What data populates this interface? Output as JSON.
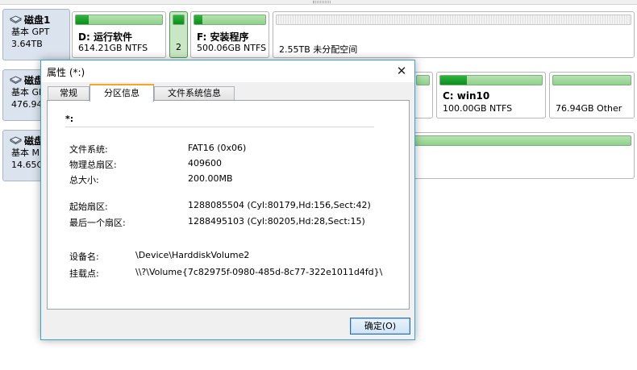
{
  "disks": [
    {
      "name": "磁盘1",
      "type": "基本 GPT",
      "size": "3.64TB",
      "partitions": [
        {
          "title": "D: 运行软件",
          "size": "614.21GB NTFS",
          "fill": 0.15
        },
        {
          "number": "2",
          "fill": 1.0
        },
        {
          "title": "F: 安装程序",
          "size": "500.06GB NTFS",
          "fill": 0.11
        },
        {
          "title": "",
          "size": "2.55TB 未分配空间",
          "unallocated": true
        }
      ]
    },
    {
      "name": "磁盘",
      "type": "基本 GI",
      "size": "476.94",
      "partitions": [
        {
          "title": "C: win10",
          "size": "100.00GB NTFS",
          "fill": 0.26
        },
        {
          "title": "",
          "size": "76.94GB Other",
          "fill": 0.0
        }
      ]
    },
    {
      "name": "磁盘",
      "type": "基本 M",
      "size": "14.65G",
      "partitions": [
        {
          "title": "",
          "size": "",
          "fill": 0.0
        }
      ]
    }
  ],
  "dialog": {
    "title": "属性 (*:)",
    "close_glyph": "✕",
    "tabs": [
      "常规",
      "分区信息",
      "文件系统信息"
    ],
    "active_tab": "分区信息",
    "drive_label": "*:",
    "fields": [
      {
        "label": "文件系统:",
        "value": "FAT16 (0x06)"
      },
      {
        "label": "物理总扇区:",
        "value": "409600"
      },
      {
        "label": "总大小:",
        "value": "200.00MB"
      },
      {
        "label": "起始扇区:",
        "value": "1288085504  (Cyl:80179,Hd:156,Sect:42)"
      },
      {
        "label": "最后一个扇区:",
        "value": "1288495103  (Cyl:80205,Hd:28,Sect:15)"
      },
      {
        "label": "设备名:",
        "value": "\\Device\\HarddiskVolume2"
      },
      {
        "label": "挂载点:",
        "value": "\\\\?\\Volume{7c82975f-0980-485d-8c77-322e1011d4fd}\\"
      }
    ],
    "ok_label": "确定(O)"
  },
  "colors": {
    "accent": "#3aa3d7",
    "bar_used": "#0c8d1f",
    "bar_free": "#a9dda3",
    "disk_panel": "#dbe3ee",
    "tab_accent": "#f5a623"
  }
}
